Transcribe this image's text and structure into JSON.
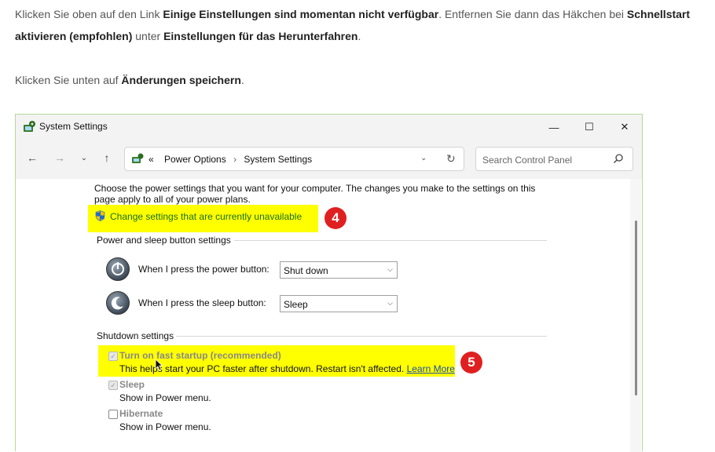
{
  "article": {
    "p1_a": "Klicken Sie oben auf den Link ",
    "p1_b": "Einige Einstellungen sind momentan nicht verfügbar",
    "p1_c": ". Entfernen Sie dann das Häkchen bei ",
    "p1_d": "Schnellstart aktivieren (empfohlen)",
    "p1_e": " unter ",
    "p1_f": "Einstellungen für das Herunterfahren",
    "p1_g": ".",
    "p2_a": "Klicken Sie unten auf ",
    "p2_b": "Änderungen speichern",
    "p2_c": "."
  },
  "window": {
    "title": "System Settings",
    "controls": {
      "minimize": "—",
      "maximize": "☐",
      "close": "✕"
    }
  },
  "nav": {
    "back": "←",
    "forward": "→",
    "recent": "⌄",
    "up": "↑",
    "crumb_more": "«",
    "breadcrumbs": [
      "Power Options",
      "System Settings"
    ],
    "crumb_sep": "›",
    "dropdown": "⌄",
    "refresh": "↻",
    "search_placeholder": "Search Control Panel"
  },
  "content": {
    "description": "Choose the power settings that you want for your computer. The changes you make to the settings on this page apply to all of your power plans.",
    "change_link": "Change settings that are currently unavailable",
    "badge4": "4",
    "badge5": "5",
    "power_sleep_heading": "Power and sleep button settings",
    "power_button_label": "When I press the power button:",
    "power_button_value": "Shut down",
    "sleep_button_label": "When I press the sleep button:",
    "sleep_button_value": "Sleep",
    "shutdown_heading": "Shutdown settings",
    "options": [
      {
        "label": "Turn on fast startup (recommended)",
        "desc": "This helps start your PC faster after shutdown. Restart isn't affected. ",
        "link": "Learn More",
        "checked": true
      },
      {
        "label": "Sleep",
        "desc": "Show in Power menu.",
        "checked": true
      },
      {
        "label": "Hibernate",
        "desc": "Show in Power menu.",
        "checked": false
      }
    ]
  },
  "colors": {
    "highlight": "#ffff00",
    "badge": "#e02020",
    "link_green": "#1a6e1a"
  }
}
